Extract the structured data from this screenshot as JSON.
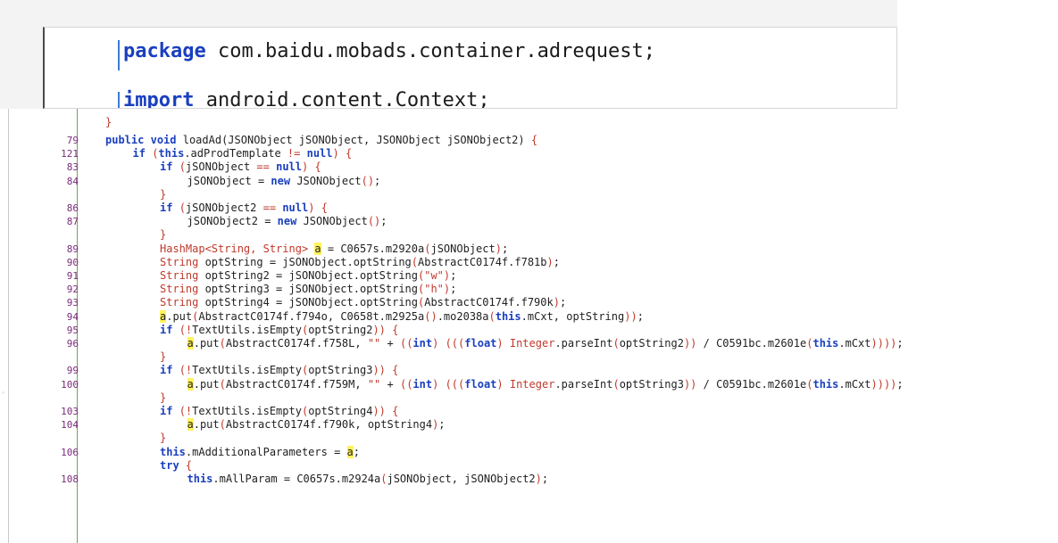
{
  "top_editor": {
    "line1": {
      "keyword": "package",
      "rest": " com.baidu.mobads.container.adrequest;"
    },
    "line2": {
      "keyword": "import",
      "rest": " android.content.Context;"
    }
  },
  "code": {
    "partial_top": "}",
    "lines": [
      {
        "n": "79",
        "indent": 0,
        "tokens": [
          [
            "k",
            "public"
          ],
          [
            "p",
            " "
          ],
          [
            "k",
            "void"
          ],
          [
            "p",
            " loadAd(JSONObject jSONObject, JSONObject jSONObject2) "
          ],
          [
            "o",
            "{"
          ]
        ]
      },
      {
        "n": "121",
        "indent": 1,
        "tokens": [
          [
            "k",
            "if"
          ],
          [
            "p",
            " "
          ],
          [
            "o",
            "("
          ],
          [
            "k",
            "this"
          ],
          [
            "p",
            ".adProdTemplate "
          ],
          [
            "o",
            "!="
          ],
          [
            "p",
            " "
          ],
          [
            "k",
            "null"
          ],
          [
            "o",
            ")"
          ],
          [
            "p",
            " "
          ],
          [
            "o",
            "{"
          ]
        ]
      },
      {
        "n": "83",
        "indent": 2,
        "tokens": [
          [
            "k",
            "if"
          ],
          [
            "p",
            " "
          ],
          [
            "o",
            "("
          ],
          [
            "p",
            "jSONObject "
          ],
          [
            "o",
            "=="
          ],
          [
            "p",
            " "
          ],
          [
            "k",
            "null"
          ],
          [
            "o",
            ")"
          ],
          [
            "p",
            " "
          ],
          [
            "o",
            "{"
          ]
        ]
      },
      {
        "n": "84",
        "indent": 3,
        "tokens": [
          [
            "p",
            "jSONObject = "
          ],
          [
            "k",
            "new"
          ],
          [
            "p",
            " JSONObject"
          ],
          [
            "o",
            "()"
          ],
          [
            "p",
            ";"
          ]
        ]
      },
      {
        "n": "",
        "indent": 2,
        "tokens": [
          [
            "o",
            "}"
          ]
        ]
      },
      {
        "n": "86",
        "indent": 2,
        "tokens": [
          [
            "k",
            "if"
          ],
          [
            "p",
            " "
          ],
          [
            "o",
            "("
          ],
          [
            "p",
            "jSONObject2 "
          ],
          [
            "o",
            "=="
          ],
          [
            "p",
            " "
          ],
          [
            "k",
            "null"
          ],
          [
            "o",
            ")"
          ],
          [
            "p",
            " "
          ],
          [
            "o",
            "{"
          ]
        ]
      },
      {
        "n": "87",
        "indent": 3,
        "tokens": [
          [
            "p",
            "jSONObject2 = "
          ],
          [
            "k",
            "new"
          ],
          [
            "p",
            " JSONObject"
          ],
          [
            "o",
            "()"
          ],
          [
            "p",
            ";"
          ]
        ]
      },
      {
        "n": "",
        "indent": 2,
        "tokens": [
          [
            "o",
            "}"
          ]
        ]
      },
      {
        "n": "89",
        "indent": 2,
        "tokens": [
          [
            "t",
            "HashMap<String, String>"
          ],
          [
            "p",
            " "
          ],
          [
            "h",
            "a"
          ],
          [
            "p",
            " = C0657s.m2920a"
          ],
          [
            "o",
            "("
          ],
          [
            "p",
            "jSONObject"
          ],
          [
            "o",
            ")"
          ],
          [
            "p",
            ";"
          ]
        ]
      },
      {
        "n": "90",
        "indent": 2,
        "tokens": [
          [
            "t",
            "String"
          ],
          [
            "p",
            " optString = jSONObject.optString"
          ],
          [
            "o",
            "("
          ],
          [
            "p",
            "AbstractC0174f.f781b"
          ],
          [
            "o",
            ")"
          ],
          [
            "p",
            ";"
          ]
        ]
      },
      {
        "n": "91",
        "indent": 2,
        "tokens": [
          [
            "t",
            "String"
          ],
          [
            "p",
            " optString2 = jSONObject.optString"
          ],
          [
            "o",
            "("
          ],
          [
            "s",
            "\"w\""
          ],
          [
            "o",
            ")"
          ],
          [
            "p",
            ";"
          ]
        ]
      },
      {
        "n": "92",
        "indent": 2,
        "tokens": [
          [
            "t",
            "String"
          ],
          [
            "p",
            " optString3 = jSONObject.optString"
          ],
          [
            "o",
            "("
          ],
          [
            "s",
            "\"h\""
          ],
          [
            "o",
            ")"
          ],
          [
            "p",
            ";"
          ]
        ]
      },
      {
        "n": "93",
        "indent": 2,
        "tokens": [
          [
            "t",
            "String"
          ],
          [
            "p",
            " optString4 = jSONObject.optString"
          ],
          [
            "o",
            "("
          ],
          [
            "p",
            "AbstractC0174f.f790k"
          ],
          [
            "o",
            ")"
          ],
          [
            "p",
            ";"
          ]
        ]
      },
      {
        "n": "94",
        "indent": 2,
        "tokens": [
          [
            "h",
            "a"
          ],
          [
            "p",
            ".put"
          ],
          [
            "o",
            "("
          ],
          [
            "p",
            "AbstractC0174f.f794o, C0658t.m2925a"
          ],
          [
            "o",
            "()"
          ],
          [
            "p",
            ".mo2038a"
          ],
          [
            "o",
            "("
          ],
          [
            "k",
            "this"
          ],
          [
            "p",
            ".mCxt, optString"
          ],
          [
            "o",
            "))"
          ],
          [
            "p",
            ";"
          ]
        ]
      },
      {
        "n": "95",
        "indent": 2,
        "tokens": [
          [
            "k",
            "if"
          ],
          [
            "p",
            " "
          ],
          [
            "o",
            "(!"
          ],
          [
            "p",
            "TextUtils.isEmpty"
          ],
          [
            "o",
            "("
          ],
          [
            "p",
            "optString2"
          ],
          [
            "o",
            "))"
          ],
          [
            "p",
            " "
          ],
          [
            "o",
            "{"
          ]
        ]
      },
      {
        "n": "96",
        "indent": 3,
        "tokens": [
          [
            "h",
            "a"
          ],
          [
            "p",
            ".put"
          ],
          [
            "o",
            "("
          ],
          [
            "p",
            "AbstractC0174f.f758L, "
          ],
          [
            "s",
            "\"\""
          ],
          [
            "p",
            " + "
          ],
          [
            "o",
            "(("
          ],
          [
            "k",
            "int"
          ],
          [
            "o",
            ")"
          ],
          [
            "p",
            " "
          ],
          [
            "o",
            "((("
          ],
          [
            "k",
            "float"
          ],
          [
            "o",
            ")"
          ],
          [
            "p",
            " "
          ],
          [
            "t",
            "Integer"
          ],
          [
            "p",
            ".parseInt"
          ],
          [
            "o",
            "("
          ],
          [
            "p",
            "optString2"
          ],
          [
            "o",
            "))"
          ],
          [
            "p",
            " / C0591bc.m2601e"
          ],
          [
            "o",
            "("
          ],
          [
            "k",
            "this"
          ],
          [
            "p",
            ".mCxt"
          ],
          [
            "o",
            "))))"
          ],
          [
            "p",
            ";"
          ]
        ]
      },
      {
        "n": "",
        "indent": 2,
        "tokens": [
          [
            "o",
            "}"
          ]
        ]
      },
      {
        "n": "99",
        "indent": 2,
        "tokens": [
          [
            "k",
            "if"
          ],
          [
            "p",
            " "
          ],
          [
            "o",
            "(!"
          ],
          [
            "p",
            "TextUtils.isEmpty"
          ],
          [
            "o",
            "("
          ],
          [
            "p",
            "optString3"
          ],
          [
            "o",
            "))"
          ],
          [
            "p",
            " "
          ],
          [
            "o",
            "{"
          ]
        ]
      },
      {
        "n": "100",
        "indent": 3,
        "tokens": [
          [
            "h",
            "a"
          ],
          [
            "p",
            ".put"
          ],
          [
            "o",
            "("
          ],
          [
            "p",
            "AbstractC0174f.f759M, "
          ],
          [
            "s",
            "\"\""
          ],
          [
            "p",
            " + "
          ],
          [
            "o",
            "(("
          ],
          [
            "k",
            "int"
          ],
          [
            "o",
            ")"
          ],
          [
            "p",
            " "
          ],
          [
            "o",
            "((("
          ],
          [
            "k",
            "float"
          ],
          [
            "o",
            ")"
          ],
          [
            "p",
            " "
          ],
          [
            "t",
            "Integer"
          ],
          [
            "p",
            ".parseInt"
          ],
          [
            "o",
            "("
          ],
          [
            "p",
            "optString3"
          ],
          [
            "o",
            "))"
          ],
          [
            "p",
            " / C0591bc.m2601e"
          ],
          [
            "o",
            "("
          ],
          [
            "k",
            "this"
          ],
          [
            "p",
            ".mCxt"
          ],
          [
            "o",
            "))))"
          ],
          [
            "p",
            ";"
          ]
        ]
      },
      {
        "n": "",
        "indent": 2,
        "tokens": [
          [
            "o",
            "}"
          ]
        ]
      },
      {
        "n": "103",
        "indent": 2,
        "tokens": [
          [
            "k",
            "if"
          ],
          [
            "p",
            " "
          ],
          [
            "o",
            "(!"
          ],
          [
            "p",
            "TextUtils.isEmpty"
          ],
          [
            "o",
            "("
          ],
          [
            "p",
            "optString4"
          ],
          [
            "o",
            "))"
          ],
          [
            "p",
            " "
          ],
          [
            "o",
            "{"
          ]
        ]
      },
      {
        "n": "104",
        "indent": 3,
        "tokens": [
          [
            "h",
            "a"
          ],
          [
            "p",
            ".put"
          ],
          [
            "o",
            "("
          ],
          [
            "p",
            "AbstractC0174f.f790k, optString4"
          ],
          [
            "o",
            ")"
          ],
          [
            "p",
            ";"
          ]
        ]
      },
      {
        "n": "",
        "indent": 2,
        "tokens": [
          [
            "o",
            "}"
          ]
        ]
      },
      {
        "n": "106",
        "indent": 2,
        "tokens": [
          [
            "k",
            "this"
          ],
          [
            "p",
            ".mAdditionalParameters = "
          ],
          [
            "h",
            "a"
          ],
          [
            "p",
            ";"
          ]
        ]
      },
      {
        "n": "",
        "indent": 2,
        "tokens": [
          [
            "k",
            "try"
          ],
          [
            "p",
            " "
          ],
          [
            "o",
            "{"
          ]
        ]
      },
      {
        "n": "108",
        "indent": 3,
        "tokens": [
          [
            "k",
            "this"
          ],
          [
            "p",
            ".mAllParam = C0657s.m2924a"
          ],
          [
            "o",
            "("
          ],
          [
            "p",
            "jSONObject, jSONObject2"
          ],
          [
            "o",
            ")"
          ],
          [
            "p",
            ";"
          ]
        ]
      }
    ]
  }
}
